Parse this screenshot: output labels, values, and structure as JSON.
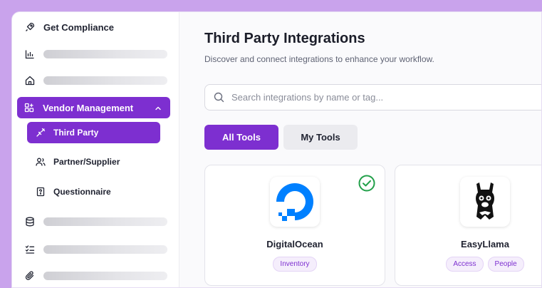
{
  "sidebar": {
    "get_compliance": "Get Compliance",
    "vendor_management": "Vendor Management",
    "sub_items": {
      "third_party": "Third Party",
      "partner_supplier": "Partner/Supplier",
      "questionnaire": "Questionnaire"
    }
  },
  "main": {
    "title": "Third Party Integrations",
    "subtitle": "Discover and connect integrations to enhance your workflow.",
    "search_placeholder": "Search integrations by name or tag...",
    "tabs": {
      "all": "All Tools",
      "mine": "My Tools"
    },
    "cards": [
      {
        "name": "DigitalOcean",
        "tags": [
          "Inventory"
        ],
        "connected": true
      },
      {
        "name": "EasyLlama",
        "tags": [
          "Access",
          "People"
        ],
        "connected": false
      }
    ]
  },
  "colors": {
    "accent": "#7d2fd0",
    "background": "#c9a3ec",
    "success": "#22a04a",
    "digitalocean_blue": "#0080ff"
  }
}
